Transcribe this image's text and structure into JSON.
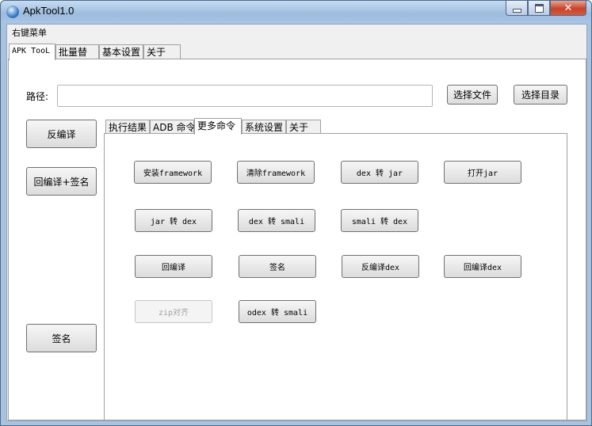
{
  "window": {
    "title": "ApkTool1.0"
  },
  "menu": {
    "label": "右键菜单"
  },
  "main_tabs": [
    "APK TooL",
    "批量替换",
    "基本设置",
    "关于"
  ],
  "path": {
    "label": "路径:",
    "value": "",
    "select_file": "选择文件",
    "select_dir": "选择目录"
  },
  "left_buttons": {
    "decompile": "反编译",
    "recompile_sign": "回编译+签名",
    "sign": "签名"
  },
  "inner_tabs": [
    "执行结果",
    "ADB 命令",
    "更多命令",
    "系统设置",
    "关于"
  ],
  "commands": {
    "row1": [
      "安装framework",
      "清除framework",
      "dex 转 jar",
      "打开jar"
    ],
    "row2": [
      "jar 转 dex",
      "dex 转 smali",
      "smali 转 dex"
    ],
    "row3": [
      "回编译",
      "签名",
      "反编译dex",
      "回编译dex"
    ],
    "row4": [
      "zip对齐",
      "odex 转 smali"
    ]
  }
}
